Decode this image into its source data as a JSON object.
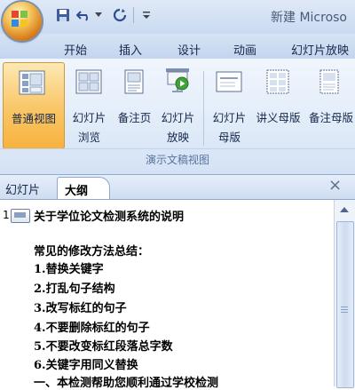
{
  "app": {
    "title": "新建 Microso"
  },
  "tabs": [
    "开始",
    "插入",
    "设计",
    "动画",
    "幻灯片放映"
  ],
  "ribbon": {
    "buttons": [
      {
        "label1": "普通视图",
        "label2": "",
        "icon": "normal-view-icon",
        "active": true
      },
      {
        "label1": "幻灯片",
        "label2": "浏览",
        "icon": "slide-sorter-icon"
      },
      {
        "label1": "备注页",
        "label2": "",
        "icon": "notes-page-icon"
      },
      {
        "label1": "幻灯片",
        "label2": "放映",
        "icon": "slide-show-icon"
      },
      {
        "label1": "幻灯片",
        "label2": "母版",
        "icon": "slide-master-icon"
      },
      {
        "label1": "讲义母版",
        "label2": "",
        "icon": "handout-master-icon"
      },
      {
        "label1": "备注母版",
        "label2": "",
        "icon": "notes-master-icon"
      }
    ],
    "group_label": "演示文稿视图"
  },
  "pane": {
    "tab_slides": "幻灯片",
    "tab_outline": "大纲",
    "close": "×"
  },
  "outline": {
    "slide_number": "1",
    "title": "关于学位论文检测系统的说明",
    "lines": [
      "常见的修改方法总结：",
      "1.替换关键字",
      "2.打乱句子结构",
      "3.改写标红的句子",
      "4.不要删除标红的句子",
      "5.不要改变标红段落总字数",
      "6.关键字用同义替换",
      "一、本检测帮助您顺利通过学校检测"
    ]
  },
  "colors": {
    "accent": "#f7b23e",
    "ribbon": "#e2ecf9",
    "frame": "#8ea8cf"
  }
}
